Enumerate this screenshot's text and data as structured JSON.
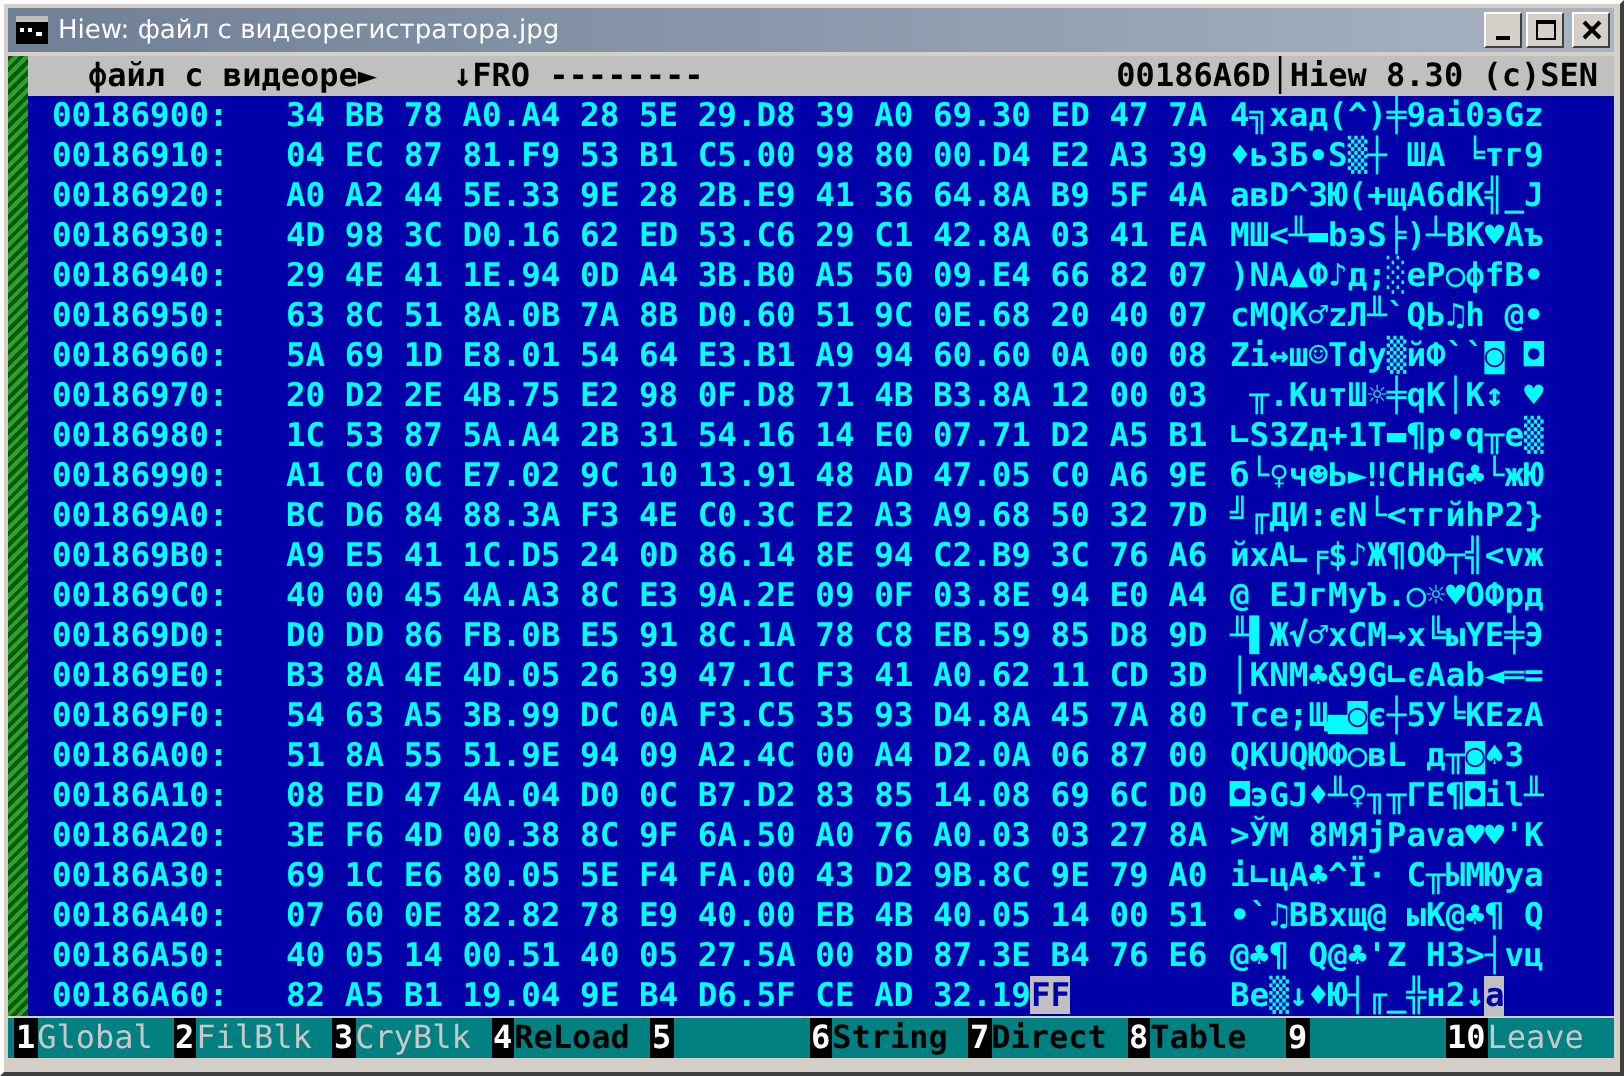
{
  "window": {
    "title": "Hiew: файл с видеорегистратора.jpg"
  },
  "header": {
    "filename": "файл с видеоре",
    "truncated_mark": "►",
    "mode": "↓FRO --------",
    "offset": "00186A6D",
    "separator": "│",
    "version": "Hiew 8.30 (c)SEN"
  },
  "rows": [
    {
      "offset": "00186900:",
      "hex": "34 BB 78 A0.A4 28 5E 29.D8 39 A0 69.30 ED 47 7A",
      "text": "4╗xад(^)╪9аi0эGz"
    },
    {
      "offset": "00186910:",
      "hex": "04 EC 87 81.F9 53 B1 C5.00 98 80 00.D4 E2 A3 39",
      "text": "♦ьЗБ∙S▒┼ ША ╘тг9"
    },
    {
      "offset": "00186920:",
      "hex": "A0 A2 44 5E.33 9E 28 2B.E9 41 36 64.8A B9 5F 4A",
      "text": "авD^3Ю(+щA6dК╣_J"
    },
    {
      "offset": "00186930:",
      "hex": "4D 98 3C D0.16 62 ED 53.C6 29 C1 42.8A 03 41 EA",
      "text": "MШ<╨▬bэS╞)┴BК♥Aъ"
    },
    {
      "offset": "00186940:",
      "hex": "29 4E 41 1E.94 0D A4 3B.B0 A5 50 09.E4 66 82 07",
      "text": ")NA▲Ф♪д;░еP○фfВ•"
    },
    {
      "offset": "00186950:",
      "hex": "63 8C 51 8A.0B 7A 8B D0.60 51 9C 0E.68 20 40 07",
      "text": "cМQК♂zЛ╨`QЬ♫h @•"
    },
    {
      "offset": "00186960:",
      "hex": "5A 69 1D E8.01 54 64 E3.B1 A9 94 60.60 0A 00 08",
      "text": "Zi↔ш☺Tdу▒йФ``◙ ◘"
    },
    {
      "offset": "00186970:",
      "hex": "20 D2 2E 4B.75 E2 98 0F.D8 71 4B B3.8A 12 00 03",
      "text": " ╥.KuтШ☼╪qK│К↕ ♥"
    },
    {
      "offset": "00186980:",
      "hex": "1C 53 87 5A.A4 2B 31 54.16 14 E0 07.71 D2 A5 B1",
      "text": "∟SЗZд+1T▬¶р•q╥е▒"
    },
    {
      "offset": "00186990:",
      "hex": "A1 C0 0C E7.02 9C 10 13.91 48 AD 47.05 C0 A6 9E",
      "text": "б└♀ч☻Ь►‼СHнG♣└жЮ"
    },
    {
      "offset": "001869A0:",
      "hex": "BC D6 84 88.3A F3 4E C0.3C E2 A3 A9.68 50 32 7D",
      "text": "╝╓ДИ:єN└<тгйhP2}"
    },
    {
      "offset": "001869B0:",
      "hex": "A9 E5 41 1C.D5 24 0D 86.14 8E 94 C2.B9 3C 76 A6",
      "text": "йхA∟╒$♪Ж¶ОФ┬╣<vж"
    },
    {
      "offset": "001869C0:",
      "hex": "40 00 45 4A.A3 8C E3 9A.2E 09 0F 03.8E 94 E0 A4",
      "text": "@ EJгМуЪ.○☼♥ОФрд"
    },
    {
      "offset": "001869D0:",
      "hex": "D0 DD 86 FB.0B E5 91 8C.1A 78 C8 EB.59 85 D8 9D",
      "text": "╨▌Ж√♂хСМ→x╚ыYЕ╪Э"
    },
    {
      "offset": "001869E0:",
      "hex": "B3 8A 4E 4D.05 26 39 47.1C F3 41 A0.62 11 CD 3D",
      "text": "│КNM♣&9G∟єAаb◄═="
    },
    {
      "offset": "001869F0:",
      "hex": "54 63 A5 3B.99 DC 0A F3.C5 35 93 D4.8A 45 7A 80",
      "text": "Tcе;Щ▄◙є┼5У╘КEzА"
    },
    {
      "offset": "00186A00:",
      "hex": "51 8A 55 51.9E 94 09 A2.4C 00 A4 D2.0A 06 87 00",
      "text": "QКUQЮФ○вL д╥◙♠З "
    },
    {
      "offset": "00186A10:",
      "hex": "08 ED 47 4A.04 D0 0C B7.D2 83 85 14.08 69 6C D0",
      "text": "◘эGJ♦╨♀╖╥ГЕ¶◘il╨"
    },
    {
      "offset": "00186A20:",
      "hex": "3E F6 4D 00.38 8C 9F 6A.50 A0 76 A0.03 03 27 8A",
      "text": ">ЎM 8МЯjPаvа♥♥'К"
    },
    {
      "offset": "00186A30:",
      "hex": "69 1C E6 80.05 5E F4 FA.00 43 D2 9B.8C 9E 79 A0",
      "text": "i∟цА♣^Ї· C╥ЫМЮyа"
    },
    {
      "offset": "00186A40:",
      "hex": "07 60 0E 82.82 78 E9 40.00 EB 4B 40.05 14 00 51",
      "text": "•`♫ВВxщ@ ыK@♣¶ Q"
    },
    {
      "offset": "00186A50:",
      "hex": "40 05 14 00.51 40 05 27.5A 00 8D 87.3E B4 76 E6",
      "text": "@♣¶ Q@♣'Z НЗ>┤vц"
    },
    {
      "offset": "00186A60:",
      "hex": "82 A5 B1 19.04 9E B4 D6.5F CE AD 32.19",
      "text": "Ве▒↓♦Ю┤╓_╬н2↓",
      "cursor_hex": "FF",
      "cursor_text": "a"
    }
  ],
  "function_keys": [
    {
      "number": "1",
      "label": "Global",
      "disabled": true
    },
    {
      "number": "2",
      "label": "FilBlk",
      "disabled": true
    },
    {
      "number": "3",
      "label": "CryBlk",
      "disabled": true
    },
    {
      "number": "4",
      "label": "ReLoad",
      "disabled": false
    },
    {
      "number": "5"
    },
    {
      "number": "6",
      "label": "String",
      "disabled": false
    },
    {
      "number": "7",
      "label": "Direct",
      "disabled": false
    },
    {
      "number": "8",
      "label": "Table",
      "disabled": false
    },
    {
      "number": "9"
    },
    {
      "number": "10",
      "label": "Leave",
      "disabled": true
    }
  ]
}
